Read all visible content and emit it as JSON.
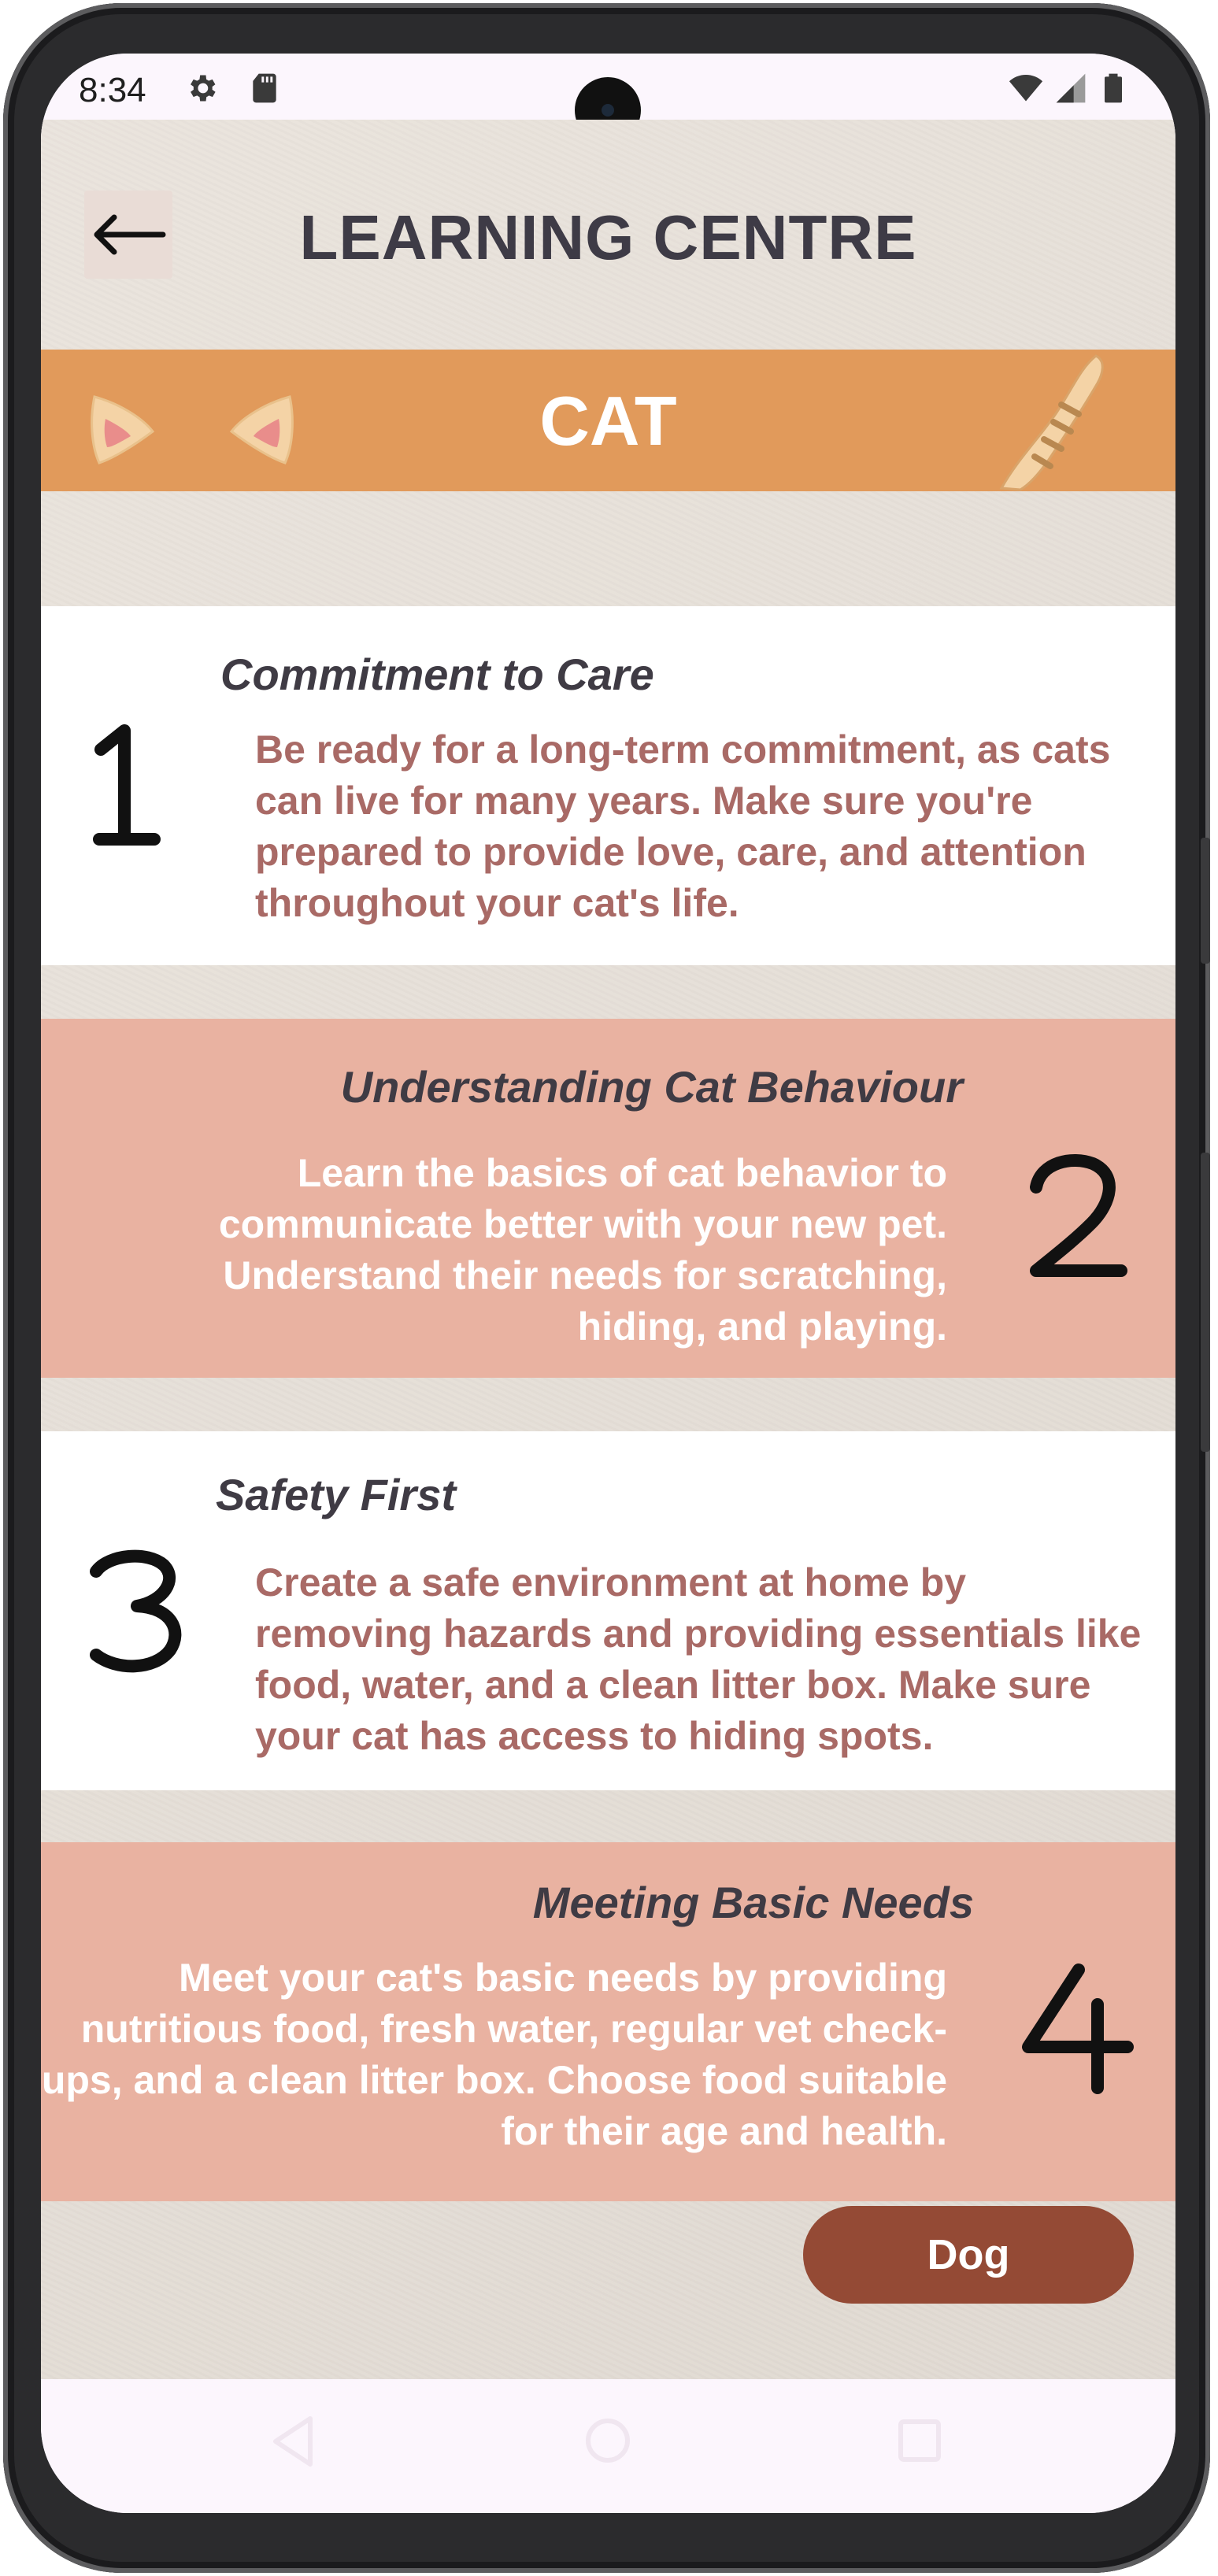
{
  "status_bar": {
    "time": "8:34",
    "left_icons": [
      "settings-icon",
      "sd-card-icon"
    ],
    "right_icons": [
      "wifi-icon",
      "signal-icon",
      "battery-icon"
    ]
  },
  "header": {
    "back_icon": "arrow-left-icon",
    "title": "LEARNING CENTRE"
  },
  "banner": {
    "title": "CAT",
    "decorations": [
      "cat-ear-icon",
      "cat-ear-icon",
      "cat-tail-icon"
    ]
  },
  "cards": [
    {
      "number": "1",
      "heading": "Commitment to Care",
      "body": "Be ready for a long-term commitment, as cats can live for many years. Make sure you're prepared to provide love, care, and attention throughout your cat's life."
    },
    {
      "number": "2",
      "heading": "Understanding Cat Behaviour",
      "body": "Learn the basics of cat behavior to communicate better with your new pet. Understand their needs for scratching, hiding, and playing."
    },
    {
      "number": "3",
      "heading": "Safety First",
      "body": "Create a safe environment at home by removing hazards and providing essentials like food, water, and a clean litter box. Make sure your cat has access to hiding spots."
    },
    {
      "number": "4",
      "heading": "Meeting Basic Needs",
      "body": "Meet your cat's basic needs by providing nutritious food, fresh water, regular vet check-ups, and a clean litter box. Choose food suitable for their age and health."
    }
  ],
  "actions": {
    "dog_button": "Dog"
  },
  "colors": {
    "banner": "#e19a5b",
    "pink_card": "#e9b2a1",
    "white_card_text": "#a96a66",
    "heading_text": "#3f3b44",
    "dog_button": "#944a35"
  },
  "nav_bar": {
    "icons": [
      "back-nav-icon",
      "home-nav-icon",
      "recents-nav-icon"
    ]
  }
}
